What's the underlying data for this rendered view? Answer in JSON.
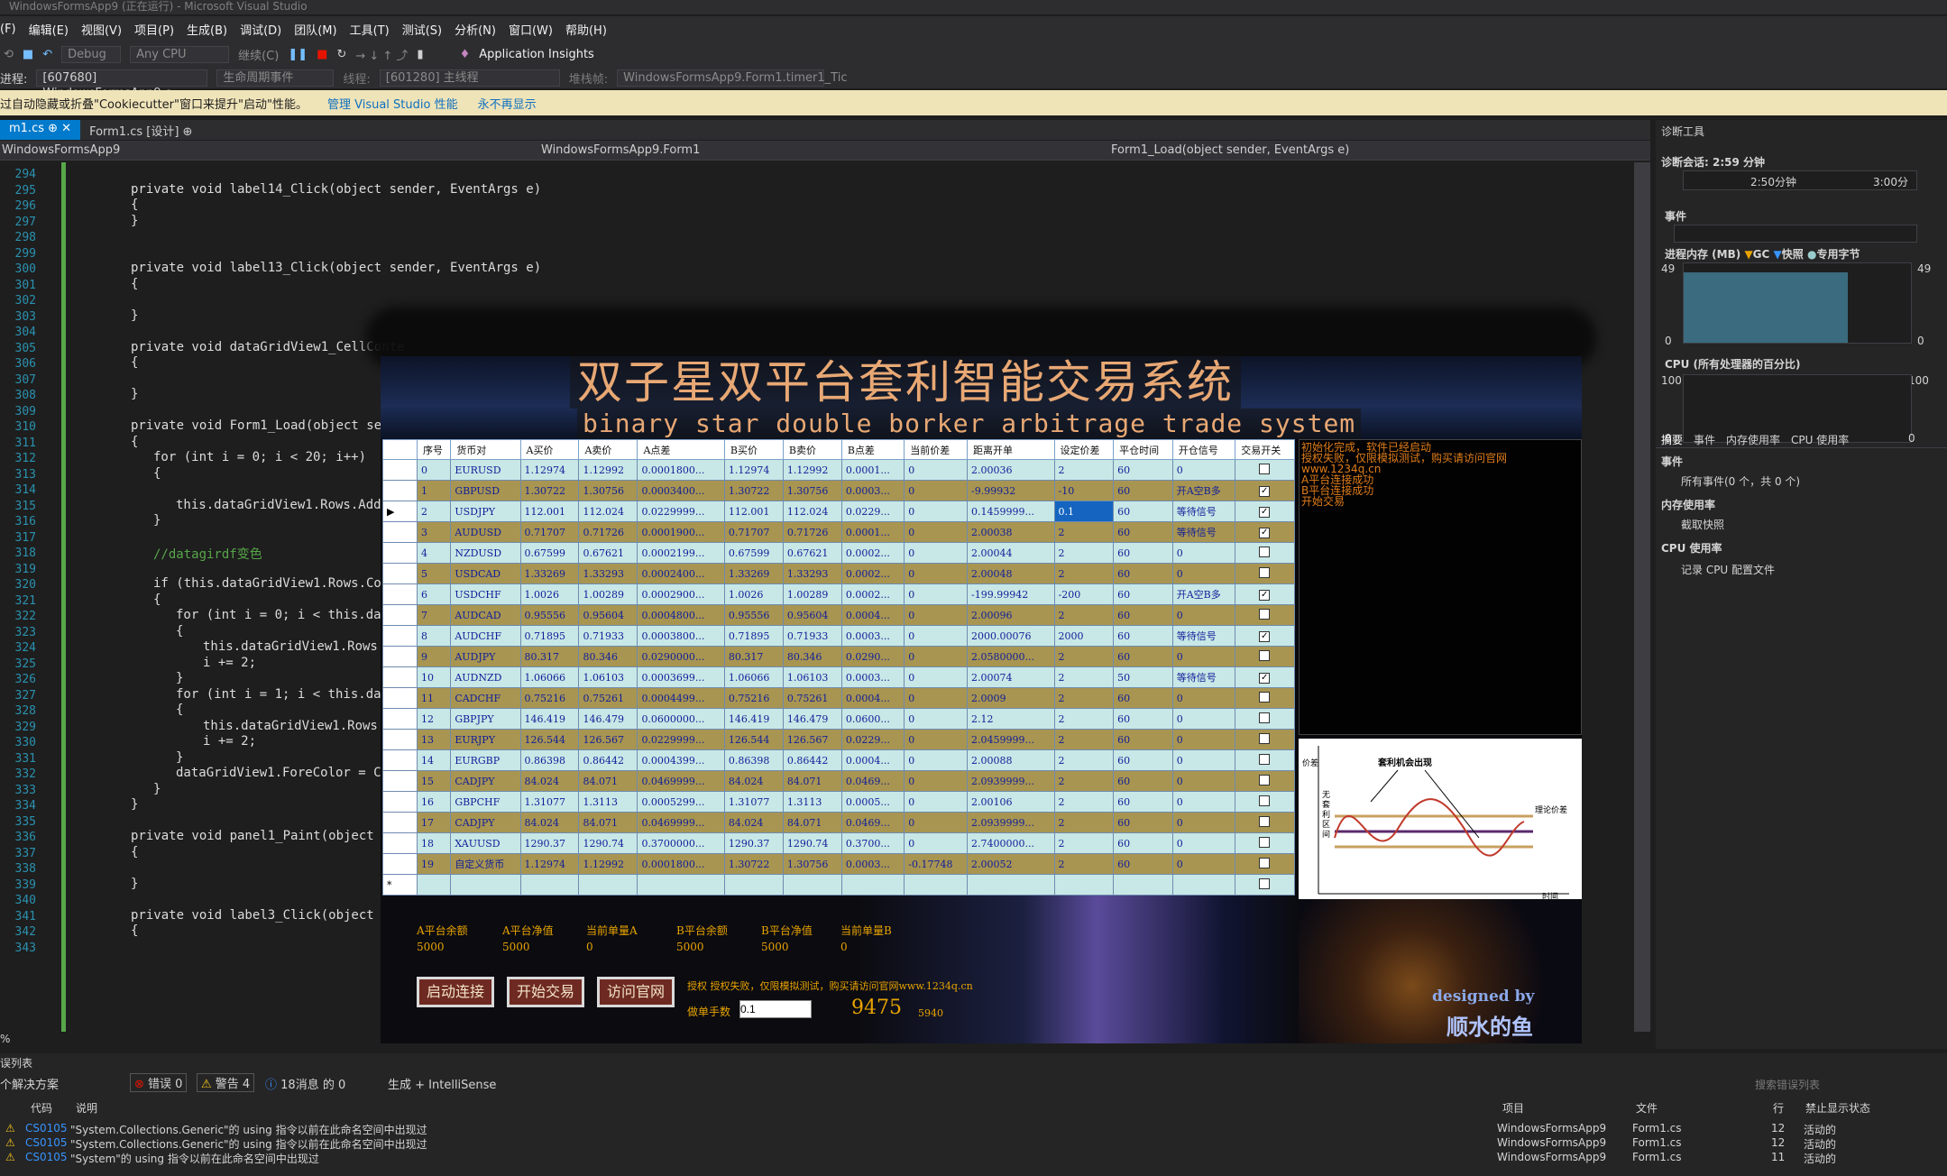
{
  "window": {
    "title": "WindowsFormsApp9 (正在运行) - Microsoft Visual Studio"
  },
  "menu": [
    "(F)",
    "编辑(E)",
    "视图(V)",
    "项目(P)",
    "生成(B)",
    "调试(D)",
    "团队(M)",
    "工具(T)",
    "测试(S)",
    "分析(N)",
    "窗口(W)",
    "帮助(H)"
  ],
  "toolbar": {
    "config": "Debug",
    "platform": "Any CPU",
    "continue": "继续(C)",
    "insights": "Application Insights"
  },
  "toolbar2": {
    "process_label": "进程:",
    "process": "[607680] WindowsFormsApp9.e",
    "lifecycle": "生命周期事件",
    "thread_label": "线程:",
    "thread": "[601280] 主线程",
    "stack_label": "堆栈帧:",
    "stack": "WindowsFormsApp9.Form1.timer1_Tic"
  },
  "infobar": {
    "message": "过自动隐藏或折叠\"Cookiecutter\"窗口来提升\"启动\"性能。",
    "link1": "管理 Visual Studio 性能",
    "link2": "永不再显示"
  },
  "tabs": {
    "tab1": "m1.cs",
    "tab2": "Form1.cs [设计]"
  },
  "nav": {
    "project": "WindowsFormsApp9",
    "class": "WindowsFormsApp9.Form1",
    "method": "Form1_Load(object sender, EventArgs e)"
  },
  "code": {
    "line_numbers": [
      "294",
      "295",
      "296",
      "297",
      "298",
      "299",
      "300",
      "301",
      "302",
      "303",
      "304",
      "305",
      "306",
      "307",
      "308",
      "309",
      "310",
      "311",
      "312",
      "313",
      "314",
      "315",
      "316",
      "317",
      "318",
      "319",
      "320",
      "321",
      "322",
      "323",
      "324",
      "325",
      "326",
      "327",
      "328",
      "329",
      "330",
      "331",
      "332",
      "333",
      "334",
      "335",
      "336",
      "337",
      "338",
      "339",
      "340",
      "341",
      "342",
      "343"
    ],
    "l295": "private void label14_Click(object sender, EventArgs e)",
    "l296": "{",
    "l297": "}",
    "l300": "private void label13_Click(object sender, EventArgs e)",
    "l301": "{",
    "l303": "}",
    "l305": "private void dataGridView1_CellConte",
    "l306": "{",
    "l308": "}",
    "l310": "private void Form1_Load(object send",
    "l311": "{",
    "l312": "for (int i = 0; i < 20; i++)",
    "l313": "{",
    "l315": "this.dataGridView1.Rows.Add",
    "l316": "}",
    "l318": "//datagirdf变色",
    "l320": "if (this.dataGridView1.Rows.Cou",
    "l321": "{",
    "l322": "for (int i = 0; i < this.da",
    "l323": "{",
    "l324": "this.dataGridView1.Rows",
    "l325": "i += 2;",
    "l326": "}",
    "l327": "for (int i = 1; i < this.da",
    "l328": "{",
    "l329": "this.dataGridView1.Rows",
    "l330": "i += 2;",
    "l331": "}",
    "l332": "dataGridView1.ForeColor = C",
    "l333": "}",
    "l334": "}",
    "l336": "private void panel1_Paint(object se",
    "l337": "{",
    "l339": "}",
    "l341": "private void label3_Click(object se",
    "l342": "{"
  },
  "zoom": "%",
  "diag": {
    "title": "诊断工具",
    "session": "诊断会话: 2:59 分钟",
    "t1": "2:50分钟",
    "t2": "3:00分",
    "events": "事件",
    "memory": "进程内存 (MB)",
    "gc": "GC",
    "snapshot": "快照",
    "private": "专用字节",
    "mem_max": "49",
    "mem_min": "0",
    "cpu": "CPU (所有处理器的百分比)",
    "cpu_max": "100",
    "cpu_min": "0",
    "tabs": [
      "摘要",
      "事件",
      "内存使用率",
      "CPU 使用率"
    ],
    "sec_events": "事件",
    "all_events": "所有事件(0 个，共 0 个)",
    "sec_mem": "内存使用率",
    "take_snapshot": "截取快照",
    "sec_cpu": "CPU 使用率",
    "record_cpu": "记录 CPU 配置文件"
  },
  "errors": {
    "title": "误列表",
    "scope": "个解决方案",
    "err": "错误 0",
    "warn": "警告 4",
    "msg": "18消息 的 0",
    "build": "生成 + IntelliSense",
    "search": "搜索错误列表",
    "cols": {
      "code": "代码",
      "desc": "说明",
      "project": "项目",
      "file": "文件",
      "line": "行",
      "suppress": "禁止显示状态"
    },
    "rows": [
      {
        "code": "CS0105",
        "desc": "\"System.Collections.Generic\"的 using 指令以前在此命名空间中出现过",
        "project": "WindowsFormsApp9",
        "file": "Form1.cs",
        "line": "12",
        "state": "活动的"
      },
      {
        "code": "CS0105",
        "desc": "\"System.Collections.Generic\"的 using 指令以前在此命名空间中出现过",
        "project": "WindowsFormsApp9",
        "file": "Form1.cs",
        "line": "12",
        "state": "活动的"
      },
      {
        "code": "CS0105",
        "desc": "\"System\"的 using 指令以前在此命名空间中出现过",
        "project": "WindowsFormsApp9",
        "file": "Form1.cs",
        "line": "11",
        "state": "活动的"
      }
    ]
  },
  "app": {
    "title_cn": "双子星双平台套利智能交易系统",
    "title_en": "binary star double borker arbitrage trade system",
    "headers": [
      "序号",
      "货币对",
      "A买价",
      "A卖价",
      "A点差",
      "B买价",
      "B卖价",
      "B点差",
      "当前价差",
      "距离开单",
      "设定价差",
      "平仓时间",
      "开仓信号",
      "交易开关"
    ],
    "rows": [
      [
        "0",
        "EURUSD",
        "1.12974",
        "1.12992",
        "0.0001800...",
        "1.12974",
        "1.12992",
        "0.0001...",
        "0",
        "2.00036",
        "2",
        "60",
        "0",
        "0"
      ],
      [
        "1",
        "GBPUSD",
        "1.30722",
        "1.30756",
        "0.0003400...",
        "1.30722",
        "1.30756",
        "0.0003...",
        "0",
        "-9.99932",
        "-10",
        "60",
        "开A空B多",
        "1"
      ],
      [
        "2",
        "USDJPY",
        "112.001",
        "112.024",
        "0.0229999...",
        "112.001",
        "112.024",
        "0.0229...",
        "0",
        "0.1459999...",
        "0.1",
        "60",
        "等待信号",
        "1"
      ],
      [
        "3",
        "AUDUSD",
        "0.71707",
        "0.71726",
        "0.0001900...",
        "0.71707",
        "0.71726",
        "0.0001...",
        "0",
        "2.00038",
        "2",
        "60",
        "等待信号",
        "1"
      ],
      [
        "4",
        "NZDUSD",
        "0.67599",
        "0.67621",
        "0.0002199...",
        "0.67599",
        "0.67621",
        "0.0002...",
        "0",
        "2.00044",
        "2",
        "60",
        "0",
        "0"
      ],
      [
        "5",
        "USDCAD",
        "1.33269",
        "1.33293",
        "0.0002400...",
        "1.33269",
        "1.33293",
        "0.0002...",
        "0",
        "2.00048",
        "2",
        "60",
        "0",
        "0"
      ],
      [
        "6",
        "USDCHF",
        "1.0026",
        "1.00289",
        "0.0002900...",
        "1.0026",
        "1.00289",
        "0.0002...",
        "0",
        "-199.99942",
        "-200",
        "60",
        "开A空B多",
        "1"
      ],
      [
        "7",
        "AUDCAD",
        "0.95556",
        "0.95604",
        "0.0004800...",
        "0.95556",
        "0.95604",
        "0.0004...",
        "0",
        "2.00096",
        "2",
        "60",
        "0",
        "0"
      ],
      [
        "8",
        "AUDCHF",
        "0.71895",
        "0.71933",
        "0.0003800...",
        "0.71895",
        "0.71933",
        "0.0003...",
        "0",
        "2000.00076",
        "2000",
        "60",
        "等待信号",
        "1"
      ],
      [
        "9",
        "AUDJPY",
        "80.317",
        "80.346",
        "0.0290000...",
        "80.317",
        "80.346",
        "0.0290...",
        "0",
        "2.0580000...",
        "2",
        "60",
        "0",
        "0"
      ],
      [
        "10",
        "AUDNZD",
        "1.06066",
        "1.06103",
        "0.0003699...",
        "1.06066",
        "1.06103",
        "0.0003...",
        "0",
        "2.00074",
        "2",
        "50",
        "等待信号",
        "1"
      ],
      [
        "11",
        "CADCHF",
        "0.75216",
        "0.75261",
        "0.0004499...",
        "0.75216",
        "0.75261",
        "0.0004...",
        "0",
        "2.0009",
        "2",
        "60",
        "0",
        "0"
      ],
      [
        "12",
        "GBPJPY",
        "146.419",
        "146.479",
        "0.0600000...",
        "146.419",
        "146.479",
        "0.0600...",
        "0",
        "2.12",
        "2",
        "60",
        "0",
        "0"
      ],
      [
        "13",
        "EURJPY",
        "126.544",
        "126.567",
        "0.0229999...",
        "126.544",
        "126.567",
        "0.0229...",
        "0",
        "2.0459999...",
        "2",
        "60",
        "0",
        "0"
      ],
      [
        "14",
        "EURGBP",
        "0.86398",
        "0.86442",
        "0.0004399...",
        "0.86398",
        "0.86442",
        "0.0004...",
        "0",
        "2.00088",
        "2",
        "60",
        "0",
        "0"
      ],
      [
        "15",
        "CADJPY",
        "84.024",
        "84.071",
        "0.0469999...",
        "84.024",
        "84.071",
        "0.0469...",
        "0",
        "2.0939999...",
        "2",
        "60",
        "0",
        "0"
      ],
      [
        "16",
        "GBPCHF",
        "1.31077",
        "1.3113",
        "0.0005299...",
        "1.31077",
        "1.3113",
        "0.0005...",
        "0",
        "2.00106",
        "2",
        "60",
        "0",
        "0"
      ],
      [
        "17",
        "CADJPY",
        "84.024",
        "84.071",
        "0.0469999...",
        "84.024",
        "84.071",
        "0.0469...",
        "0",
        "2.0939999...",
        "2",
        "60",
        "0",
        "0"
      ],
      [
        "18",
        "XAUUSD",
        "1290.37",
        "1290.74",
        "0.3700000...",
        "1290.37",
        "1290.74",
        "0.3700...",
        "0",
        "2.7400000...",
        "2",
        "60",
        "0",
        "0"
      ],
      [
        "19",
        "自定义货币",
        "1.12974",
        "1.12992",
        "0.0001800...",
        "1.30722",
        "1.30756",
        "0.0003...",
        "-0.17748",
        "2.00052",
        "2",
        "60",
        "0",
        "0"
      ]
    ],
    "log": [
      "初始化完成，软件已经启动",
      "授权失败，仅限模拟测试，购买请访问官网www.1234q.cn",
      "A平台连接成功",
      "B平台连接成功",
      "开始交易"
    ],
    "chart_img": {
      "ylabel": "价差",
      "xlabel": "时间",
      "title": "套利机会出现",
      "left": "无套利区间",
      "right": "理论价差"
    },
    "stats": {
      "a_balance_l": "A平台余额",
      "a_balance": "5000",
      "a_equity_l": "A平台净值",
      "a_equity": "5000",
      "a_orders_l": "当前单量A",
      "a_orders": "0",
      "b_balance_l": "B平台余额",
      "b_balance": "5000",
      "b_equity_l": "B平台净值",
      "b_equity": "5000",
      "b_orders_l": "当前单量B",
      "b_orders": "0"
    },
    "buttons": {
      "connect": "启动连接",
      "trade": "开始交易",
      "visit": "访问官网"
    },
    "auth_msg": "授权 授权失败，仅限模拟测试，购买请访问官网www.1234q.cn",
    "lots_label": "做单手数",
    "lots": "0.1",
    "big_num": "9475",
    "small_num": "5940",
    "designed": "designed by",
    "author": "顺水的鱼"
  }
}
